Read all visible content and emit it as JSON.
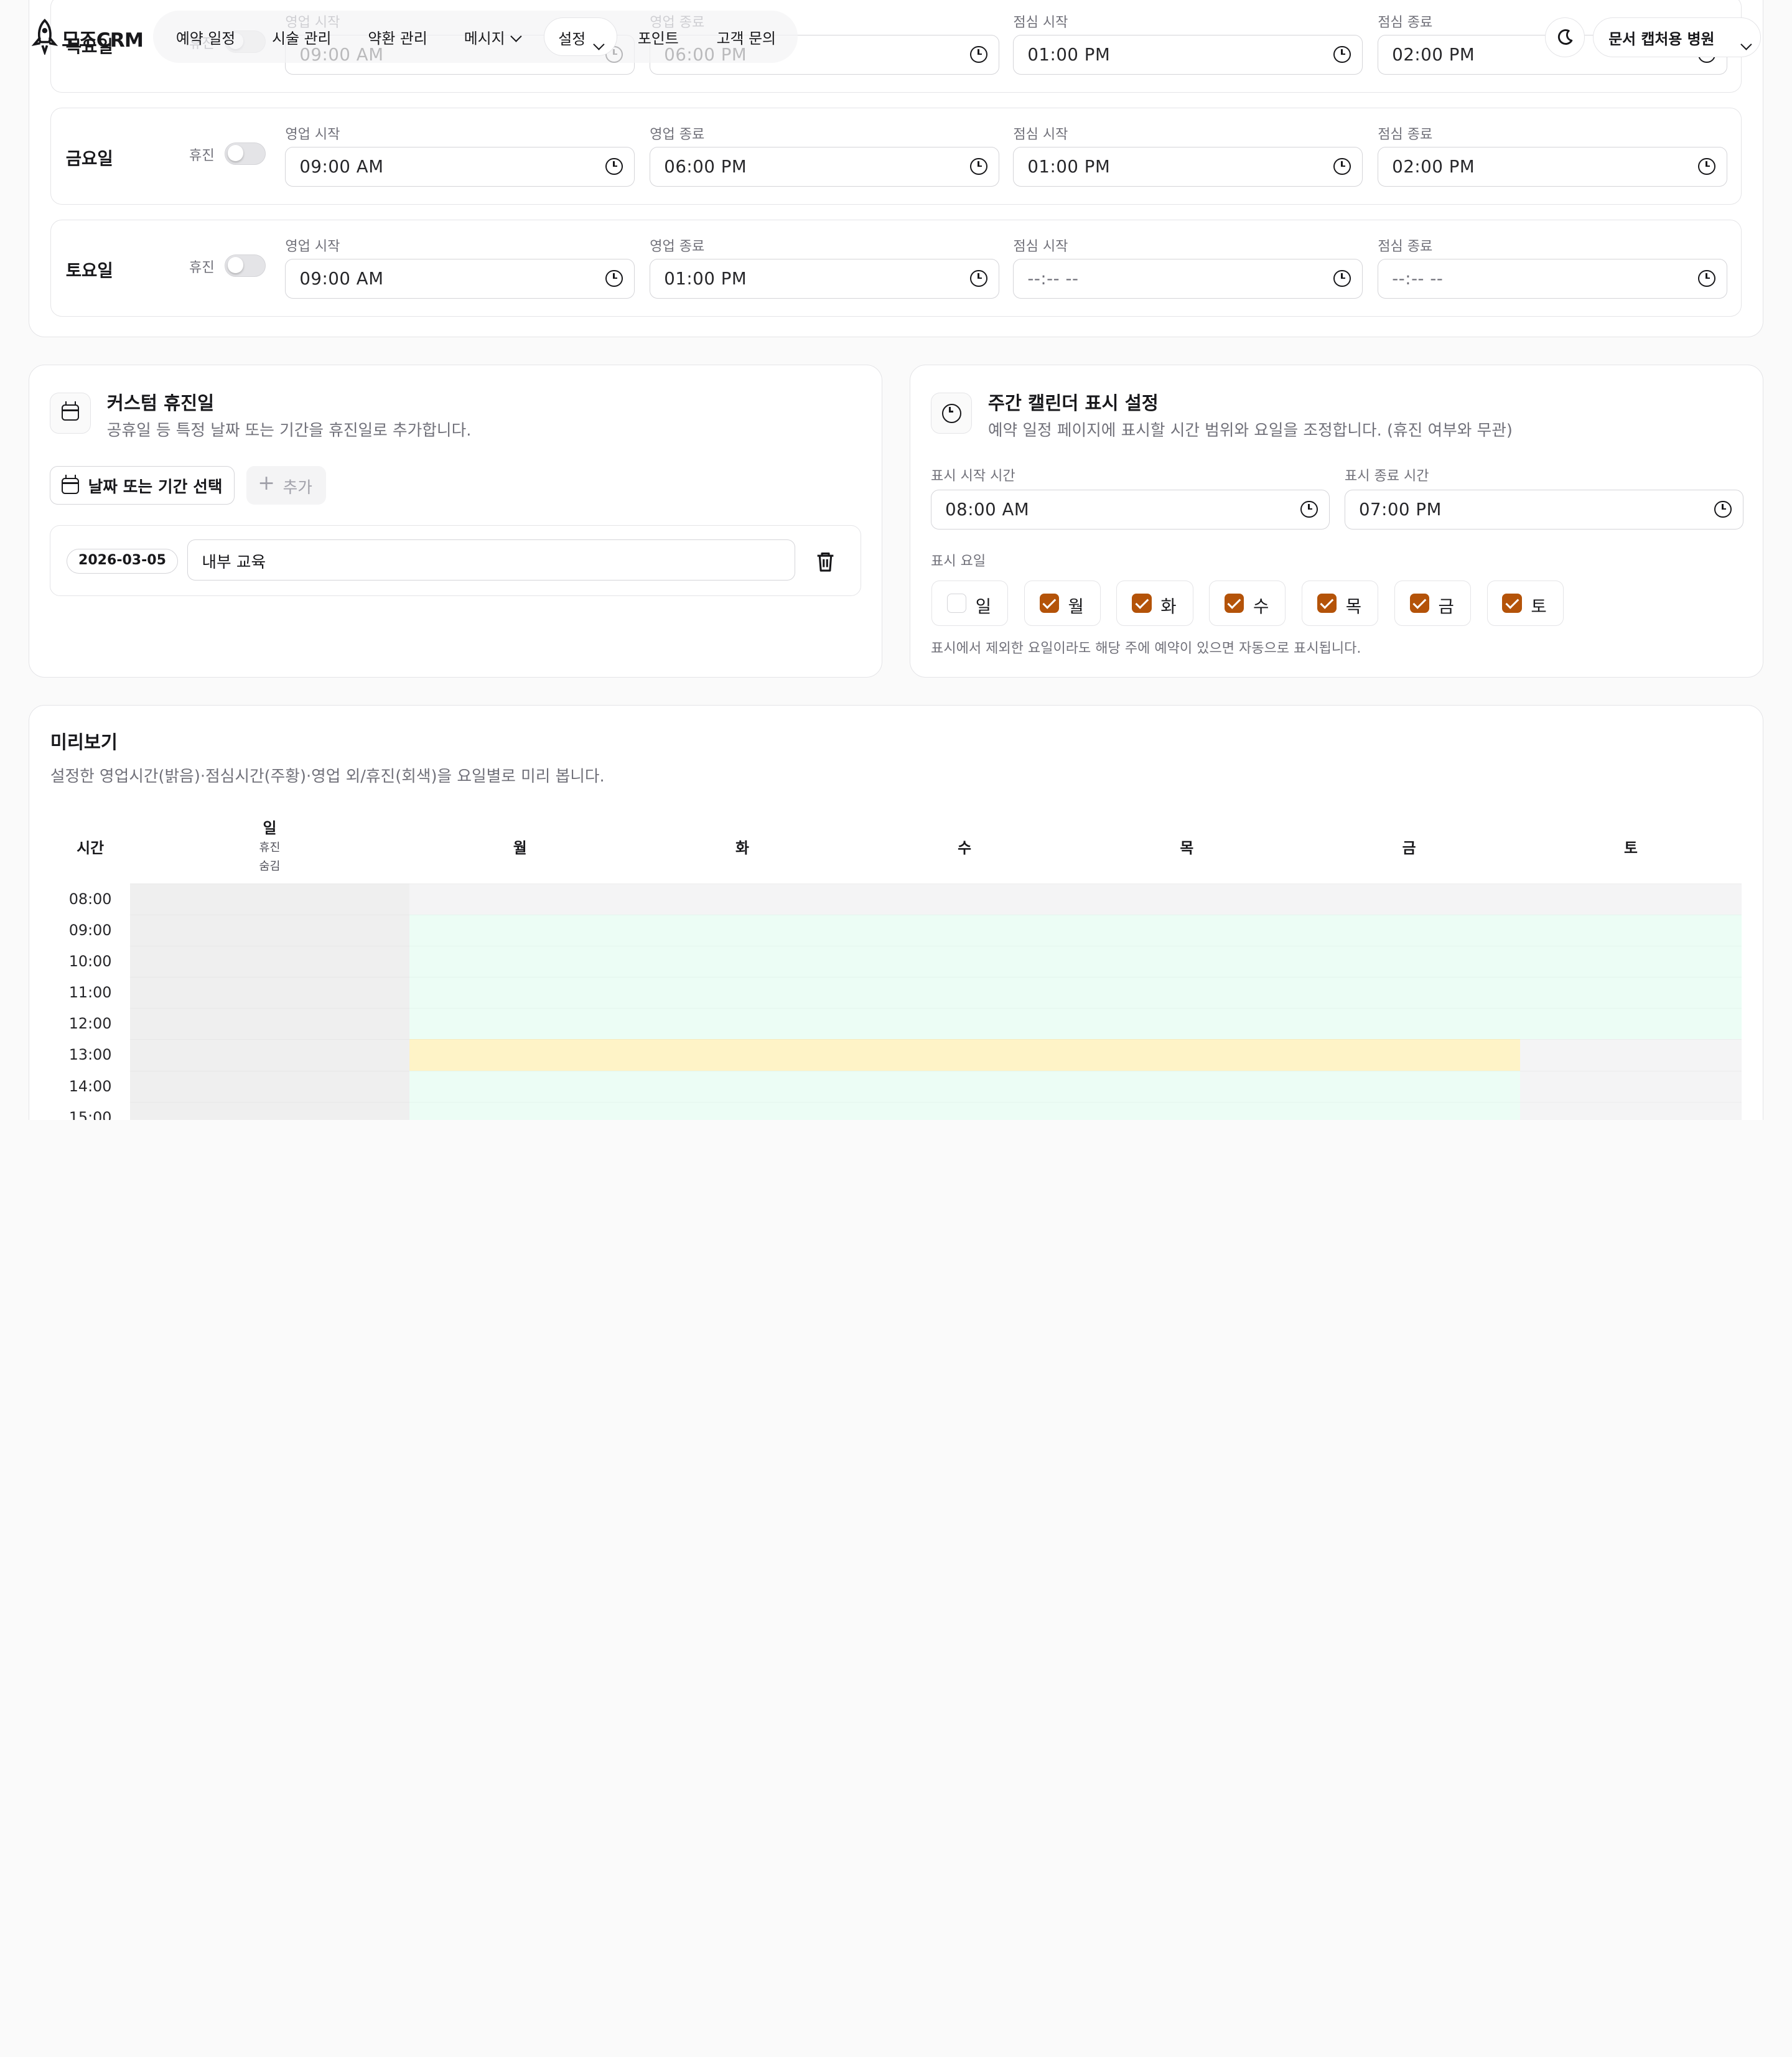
{
  "nav": {
    "logo": "모조CRM",
    "items": [
      "예약 일정",
      "시술 관리",
      "약환 관리",
      "메시지",
      "설정",
      "포인트",
      "고객 문의"
    ],
    "clinic": "문서 캡처용 병원"
  },
  "hours": {
    "field_labels": {
      "open_start": "영업 시작",
      "open_end": "영업 종료",
      "lunch_start": "점심 시작",
      "lunch_end": "점심 종료"
    },
    "closed_label": "휴진",
    "days": [
      {
        "name": "목요일",
        "closed": false,
        "open_start": "09:00 AM",
        "open_end": "06:00 PM",
        "lunch_start": "01:00 PM",
        "lunch_end": "02:00 PM"
      },
      {
        "name": "금요일",
        "closed": false,
        "open_start": "09:00 AM",
        "open_end": "06:00 PM",
        "lunch_start": "01:00 PM",
        "lunch_end": "02:00 PM"
      },
      {
        "name": "토요일",
        "closed": false,
        "open_start": "09:00 AM",
        "open_end": "01:00 PM",
        "lunch_start": "--:-- --",
        "lunch_end": "--:-- --"
      }
    ]
  },
  "custom_holidays": {
    "title": "커스텀 휴진일",
    "subtitle": "공휴일 등 특정 날짜 또는 기간을 휴진일로 추가합니다.",
    "select_label": "날짜 또는 기간 선택",
    "add_label": "추가",
    "entries": [
      {
        "date": "2026-03-05",
        "name": "내부 교육"
      }
    ]
  },
  "weekly_display": {
    "title": "주간 캘린더 표시 설정",
    "subtitle": "예약 일정 페이지에 표시할 시간 범위와 요일을 조정합니다. (휴진 여부와 무관)",
    "start_label": "표시 시작 시간",
    "start_value": "08:00 AM",
    "end_label": "표시 종료 시간",
    "end_value": "07:00 PM",
    "days_label": "표시 요일",
    "days": [
      {
        "label": "일",
        "checked": false
      },
      {
        "label": "월",
        "checked": true
      },
      {
        "label": "화",
        "checked": true
      },
      {
        "label": "수",
        "checked": true
      },
      {
        "label": "목",
        "checked": true
      },
      {
        "label": "금",
        "checked": true
      },
      {
        "label": "토",
        "checked": true
      }
    ],
    "note": "표시에서 제외한 요일이라도 해당 주에 예약이 있으면 자동으로 표시됩니다."
  },
  "preview": {
    "title": "미리보기",
    "subtitle": "설정한 영업시간(밝음)·점심시간(주황)·영업 외/휴진(회색)을 요일별로 미리 봅니다.",
    "time_header": "시간",
    "columns": [
      {
        "day": "일",
        "sub1": "휴진",
        "sub2": "숨김"
      },
      {
        "day": "월"
      },
      {
        "day": "화"
      },
      {
        "day": "수"
      },
      {
        "day": "목"
      },
      {
        "day": "금"
      },
      {
        "day": "토"
      }
    ],
    "times": [
      "08:00",
      "09:00",
      "10:00",
      "11:00",
      "12:00",
      "13:00",
      "14:00",
      "15:00"
    ],
    "colors": {
      "open": "#ecfdf5",
      "lunch": "#fef3c7",
      "off": "#f4f4f5",
      "closed": "#efefef"
    }
  }
}
